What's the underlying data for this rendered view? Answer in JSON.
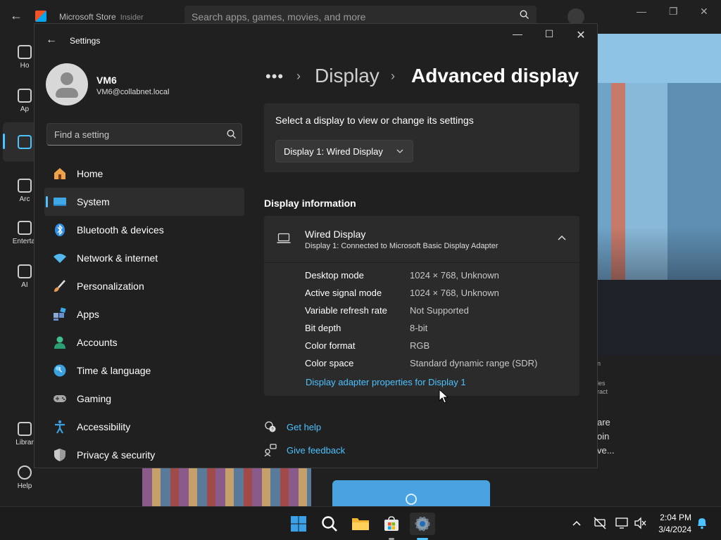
{
  "store": {
    "app_name": "Microsoft Store",
    "app_badge": "Insider",
    "search_placeholder": "Search apps, games, movies, and more",
    "nav": [
      {
        "label": "Ho"
      },
      {
        "label": "Ap"
      },
      {
        "label": ""
      },
      {
        "label": "Arc"
      },
      {
        "label": "Entertai"
      },
      {
        "label": "AI"
      },
      {
        "label": "Librar"
      },
      {
        "label": "Help"
      }
    ],
    "side_text": [
      "n",
      "les",
      "ract",
      "are",
      "oin",
      "ve..."
    ]
  },
  "settings": {
    "title": "Settings",
    "user": {
      "name": "VM6",
      "email": "VM6@collabnet.local"
    },
    "search_placeholder": "Find a setting",
    "nav": [
      {
        "label": "Home",
        "icon": "home-icon",
        "color": "#f0a24a"
      },
      {
        "label": "System",
        "icon": "system-icon",
        "color": "#3fa9e8",
        "active": true
      },
      {
        "label": "Bluetooth & devices",
        "icon": "bluetooth-icon",
        "color": "#2f8fe6"
      },
      {
        "label": "Network & internet",
        "icon": "wifi-icon",
        "color": "#52b8f0"
      },
      {
        "label": "Personalization",
        "icon": "brush-icon",
        "color": "#e69a52"
      },
      {
        "label": "Apps",
        "icon": "apps-icon",
        "color": "#6a8fcf"
      },
      {
        "label": "Accounts",
        "icon": "accounts-icon",
        "color": "#3fbf8f"
      },
      {
        "label": "Time & language",
        "icon": "globe-clock-icon",
        "color": "#3aa0e0"
      },
      {
        "label": "Gaming",
        "icon": "gamepad-icon",
        "color": "#a8a8a8"
      },
      {
        "label": "Accessibility",
        "icon": "accessibility-icon",
        "color": "#3aa0e0"
      },
      {
        "label": "Privacy & security",
        "icon": "shield-icon",
        "color": "#9a9a9a"
      }
    ],
    "breadcrumb": {
      "more": "•••",
      "parent": "Display",
      "current": "Advanced display"
    },
    "select_display": {
      "label": "Select a display to view or change its settings",
      "value": "Display 1: Wired Display"
    },
    "display_info": {
      "heading": "Display information",
      "name": "Wired Display",
      "subtitle": "Display 1: Connected to Microsoft Basic Display Adapter",
      "rows": [
        {
          "key": "Desktop mode",
          "value": "1024 × 768, Unknown"
        },
        {
          "key": "Active signal mode",
          "value": "1024 × 768, Unknown"
        },
        {
          "key": "Variable refresh rate",
          "value": "Not Supported"
        },
        {
          "key": "Bit depth",
          "value": "8-bit"
        },
        {
          "key": "Color format",
          "value": "RGB"
        },
        {
          "key": "Color space",
          "value": "Standard dynamic range (SDR)"
        }
      ],
      "link": "Display adapter properties for Display 1"
    },
    "help": {
      "get_help": "Get help",
      "give_feedback": "Give feedback"
    }
  },
  "taskbar": {
    "time": "2:04 PM",
    "date": "3/4/2024",
    "accent": "#4cc2ff"
  }
}
